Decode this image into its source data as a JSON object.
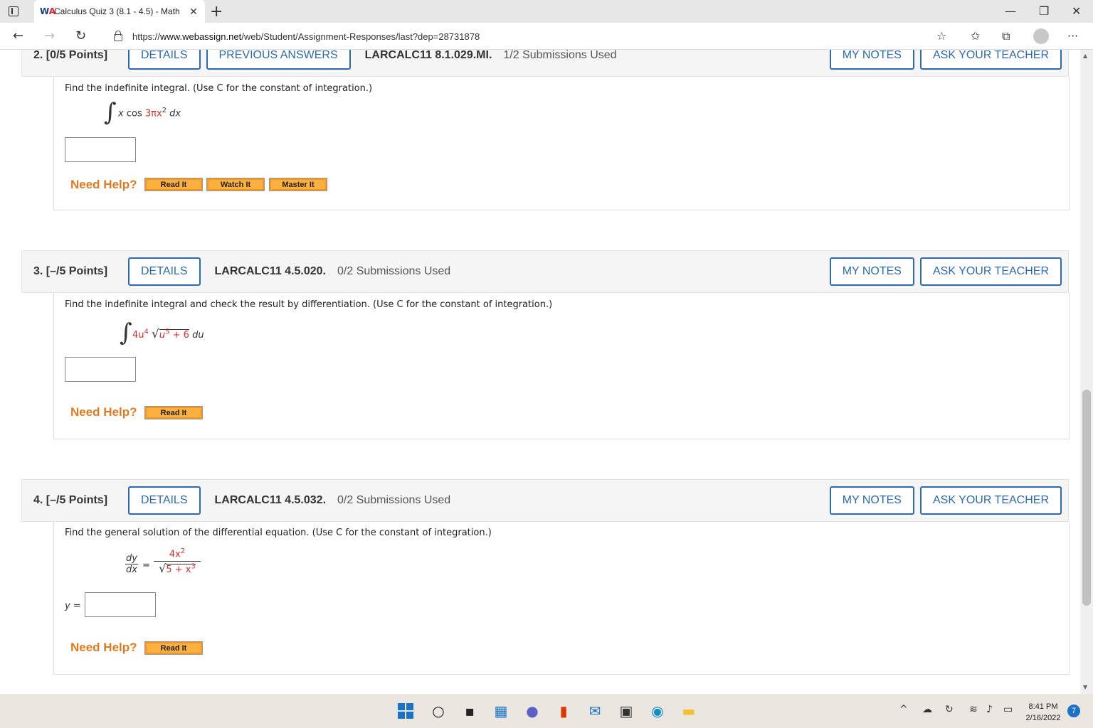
{
  "browser": {
    "tab_title": "Calculus Quiz 3 (8.1 - 4.5) - Math",
    "favicon_text": "W",
    "favicon_accent": "A",
    "url_prefix": "https://",
    "url_domain": "www.webassign.net",
    "url_path": "/web/Student/Assignment-Responses/last?dep=28731878"
  },
  "questions": [
    {
      "number": "2. [0/5 Points]",
      "buttons": [
        "DETAILS",
        "PREVIOUS ANSWERS"
      ],
      "code": "LARCALC11 8.1.029.MI.",
      "submissions": "1/2 Submissions Used",
      "my_notes": "MY NOTES",
      "ask_teacher": "ASK YOUR TEACHER",
      "prompt": "Find the indefinite integral. (Use C for the constant of integration.)",
      "integrand_x": "x",
      "integrand_cos": "cos",
      "integrand_coef": "3πx",
      "integrand_exp": "2",
      "integrand_d": "dx",
      "need_help": "Need Help?",
      "help_buttons": [
        "Read It",
        "Watch It",
        "Master It"
      ]
    },
    {
      "number": "3. [–/5 Points]",
      "buttons": [
        "DETAILS"
      ],
      "code": "LARCALC11 4.5.020.",
      "submissions": "0/2 Submissions Used",
      "my_notes": "MY NOTES",
      "ask_teacher": "ASK YOUR TEACHER",
      "prompt": "Find the indefinite integral and check the result by differentiation. (Use C for the constant of integration.)",
      "integrand_coef": "4u",
      "integrand_exp": "4",
      "radicand_base": "u",
      "radicand_exp": "5",
      "radicand_rest": "+ 6",
      "integrand_d": "du",
      "need_help": "Need Help?",
      "help_buttons": [
        "Read It"
      ]
    },
    {
      "number": "4. [–/5 Points]",
      "buttons": [
        "DETAILS"
      ],
      "code": "LARCALC11 4.5.032.",
      "submissions": "0/2 Submissions Used",
      "my_notes": "MY NOTES",
      "ask_teacher": "ASK YOUR TEACHER",
      "prompt": "Find the general solution of the differential equation. (Use C for the constant of integration.)",
      "lhs_num": "dy",
      "lhs_den": "dx",
      "equals": "=",
      "rhs_num_base": "4x",
      "rhs_num_exp": "2",
      "rhs_den": "5 + x",
      "rhs_den_exp": "3",
      "answer_label": "y =",
      "need_help": "Need Help?",
      "help_buttons": [
        "Read It"
      ]
    }
  ],
  "taskbar": {
    "time": "8:41 PM",
    "date": "2/16/2022",
    "notifications": "7"
  },
  "colors": {
    "accent_blue": "#2c6bb0",
    "help_orange": "#e07a1f",
    "math_red": "#d32f2f"
  }
}
